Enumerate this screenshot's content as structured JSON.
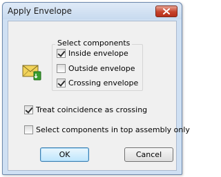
{
  "window": {
    "title": "Apply Envelope",
    "close_glyph": "✕"
  },
  "icon": {
    "name": "envelope-icon",
    "colors": {
      "envelope": "#f2d35a",
      "arrow": "#3a9e2f"
    }
  },
  "select_components": {
    "label": "Select components",
    "options": [
      {
        "label": "Inside envelope",
        "checked": true
      },
      {
        "label": "Outside envelope",
        "checked": false
      },
      {
        "label": "Crossing envelope",
        "checked": true
      }
    ]
  },
  "treat_coincidence": {
    "label": "Treat coincidence as crossing",
    "checked": true
  },
  "top_assembly_only": {
    "label": "Select components in top assembly only",
    "checked": false
  },
  "buttons": {
    "ok": "OK",
    "cancel": "Cancel"
  }
}
